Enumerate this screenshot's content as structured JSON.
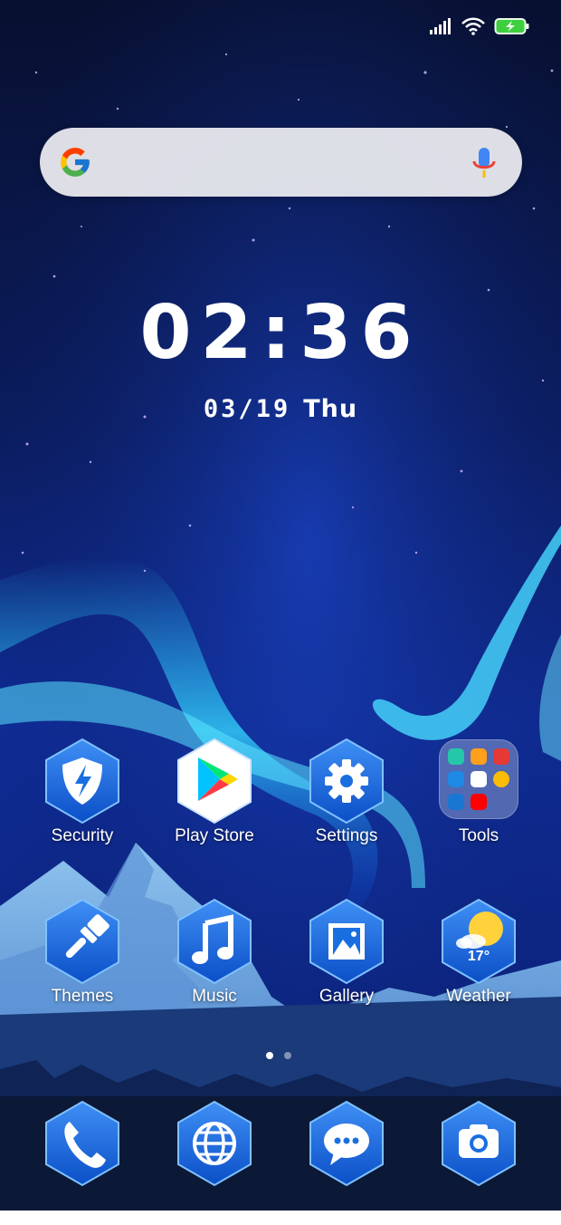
{
  "status_bar": {
    "signal_icon": "signal-bars-icon",
    "wifi_icon": "wifi-icon",
    "battery_icon": "battery-charging-icon"
  },
  "search_bar": {
    "logo": "google-g-logo",
    "mic_icon": "microphone-icon"
  },
  "clock": {
    "time": "02:36",
    "date": "03/19",
    "day": "Thu"
  },
  "apps": [
    {
      "label": "Security",
      "icon": "shield-bolt-icon"
    },
    {
      "label": "Play Store",
      "icon": "play-store-icon"
    },
    {
      "label": "Settings",
      "icon": "gear-icon"
    },
    {
      "label": "Tools",
      "icon": "folder-icon"
    },
    {
      "label": "Themes",
      "icon": "paintbrush-icon"
    },
    {
      "label": "Music",
      "icon": "music-note-icon"
    },
    {
      "label": "Gallery",
      "icon": "image-icon"
    },
    {
      "label": "Weather",
      "icon": "sun-cloud-icon",
      "temperature": "17°"
    }
  ],
  "pager": {
    "pages": 2,
    "current": 1
  },
  "dock": [
    {
      "icon": "phone-icon"
    },
    {
      "icon": "globe-icon"
    },
    {
      "icon": "chat-bubble-icon"
    },
    {
      "icon": "camera-icon"
    }
  ],
  "colors": {
    "sky_top": "#0a1233",
    "sky_mid": "#0f2a8c",
    "aurora": "#3fd6ff",
    "icon_blue": "#1a6fe0"
  }
}
